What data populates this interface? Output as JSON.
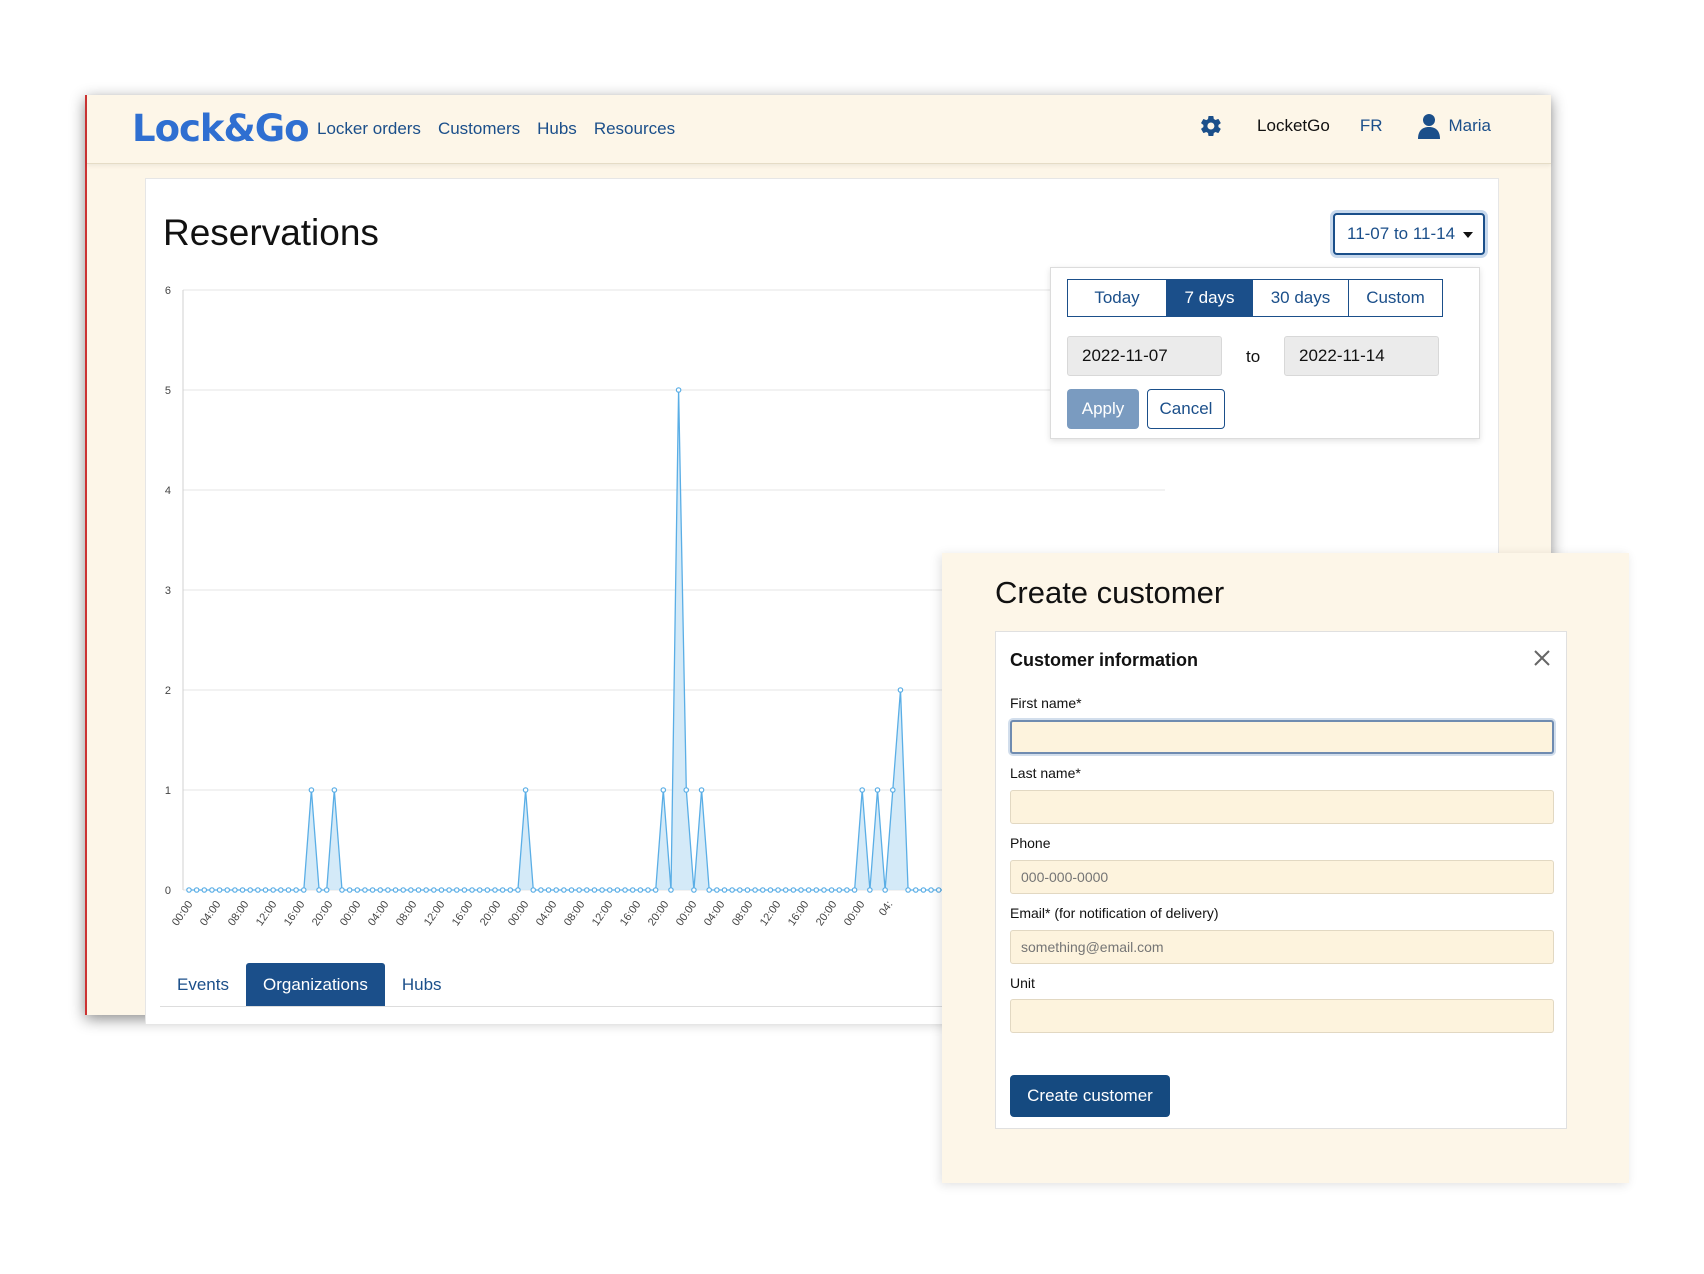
{
  "colors": {
    "brand": "#2f6fd1",
    "nav_link": "#1b4f8a",
    "primary": "#1b4f8a",
    "series": "#5aaee6",
    "fill": "#cde6f7",
    "background": "#fdf6e8"
  },
  "navbar": {
    "logo": "Lock&Go",
    "links": [
      "Locker orders",
      "Customers",
      "Hubs",
      "Resources"
    ],
    "settings_icon": "gear-icon",
    "org": "LocketGo",
    "lang": "FR",
    "user_icon": "user-icon",
    "user": "Maria"
  },
  "reservations": {
    "title": "Reservations",
    "range_button": "11-07 to 11-14"
  },
  "range_popover": {
    "options": [
      "Today",
      "7 days",
      "30 days",
      "Custom"
    ],
    "selected": "7 days",
    "start_date": "2022-11-07",
    "to_label": "to",
    "end_date": "2022-11-14",
    "apply": "Apply",
    "cancel": "Cancel"
  },
  "chart_data": {
    "type": "area",
    "title": "",
    "xlabel": "",
    "ylabel": "",
    "ylim": [
      0,
      6
    ],
    "yticks": [
      0,
      1,
      2,
      3,
      4,
      5,
      6
    ],
    "grid": true,
    "x_tick_labels": [
      "00:00",
      "04:00",
      "08:00",
      "12:00",
      "16:00",
      "20:00",
      "00:00",
      "04:00",
      "08:00",
      "12:00",
      "16:00",
      "20:00",
      "00:00",
      "04:00",
      "08:00",
      "12:00",
      "16:00",
      "20:00",
      "00:00",
      "04:00",
      "08:00",
      "12:00",
      "16:00",
      "20:00",
      "00:00",
      "04:"
    ],
    "series": [
      {
        "values": [
          0,
          0,
          0,
          0,
          0,
          0,
          0,
          0,
          0,
          0,
          0,
          0,
          0,
          0,
          0,
          0,
          1,
          0,
          0,
          1,
          0,
          0,
          0,
          0,
          0,
          0,
          0,
          0,
          0,
          0,
          0,
          0,
          0,
          0,
          0,
          0,
          0,
          0,
          0,
          0,
          0,
          0,
          0,
          0,
          1,
          0,
          0,
          0,
          0,
          0,
          0,
          0,
          0,
          0,
          0,
          0,
          0,
          0,
          0,
          0,
          0,
          0,
          1,
          0,
          5,
          1,
          0,
          1,
          0,
          0,
          0,
          0,
          0,
          0,
          0,
          0,
          0,
          0,
          0,
          0,
          0,
          0,
          0,
          0,
          0,
          0,
          0,
          0,
          1,
          0,
          1,
          0,
          1,
          2,
          0,
          0,
          0,
          0,
          0,
          0,
          0
        ]
      }
    ]
  },
  "bottom_tabs": {
    "items": [
      "Events",
      "Organizations",
      "Hubs"
    ],
    "selected": "Organizations"
  },
  "create_customer": {
    "title": "Create customer",
    "section_title": "Customer information",
    "close_icon": "close-icon",
    "first_name": {
      "label": "First name*",
      "value": "",
      "placeholder": ""
    },
    "last_name": {
      "label": "Last name*",
      "value": "",
      "placeholder": ""
    },
    "phone": {
      "label": "Phone",
      "value": "",
      "placeholder": "000-000-0000"
    },
    "email": {
      "label": "Email* (for notification of delivery)",
      "value": "",
      "placeholder": "something@email.com"
    },
    "unit": {
      "label": "Unit",
      "value": "",
      "placeholder": ""
    },
    "submit": "Create customer"
  }
}
